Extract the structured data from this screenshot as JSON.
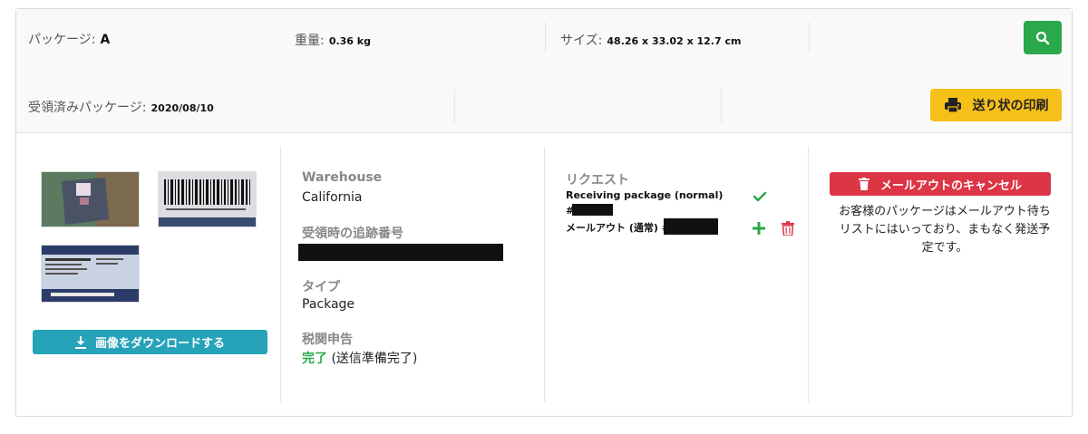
{
  "header": {
    "package_label": "パッケージ:",
    "package_value": "A",
    "weight_label": "重量:",
    "weight_value": "0.36 kg",
    "size_label": "サイズ:",
    "size_value": "48.26 x 33.02 x 12.7 cm",
    "received_label": "受領済みパッケージ:",
    "received_value": "2020/08/10",
    "print_label": "送り状の印刷"
  },
  "images": {
    "download_label": "画像をダウンロードする"
  },
  "details": {
    "warehouse_label": "Warehouse",
    "warehouse_value": "California",
    "tracking_label": "受領時の追跡番号",
    "type_label": "タイプ",
    "type_value": "Package",
    "customs_label": "税関申告",
    "customs_status": "完了",
    "customs_note": "(送信準備完了)"
  },
  "request": {
    "title": "リクエスト",
    "item1": "Receiving package (normal)",
    "item1_hash": "#",
    "item2": "メールアウト (通常) #"
  },
  "action": {
    "cancel_label": "メールアウトのキャンセル",
    "note": "お客様のパッケージはメールアウト待ちリストにはいっており、まもなく発送予定です。"
  },
  "colors": {
    "green": "#2aa84a",
    "yellow": "#f5c018",
    "teal": "#26a3b8",
    "red": "#dc3545"
  }
}
